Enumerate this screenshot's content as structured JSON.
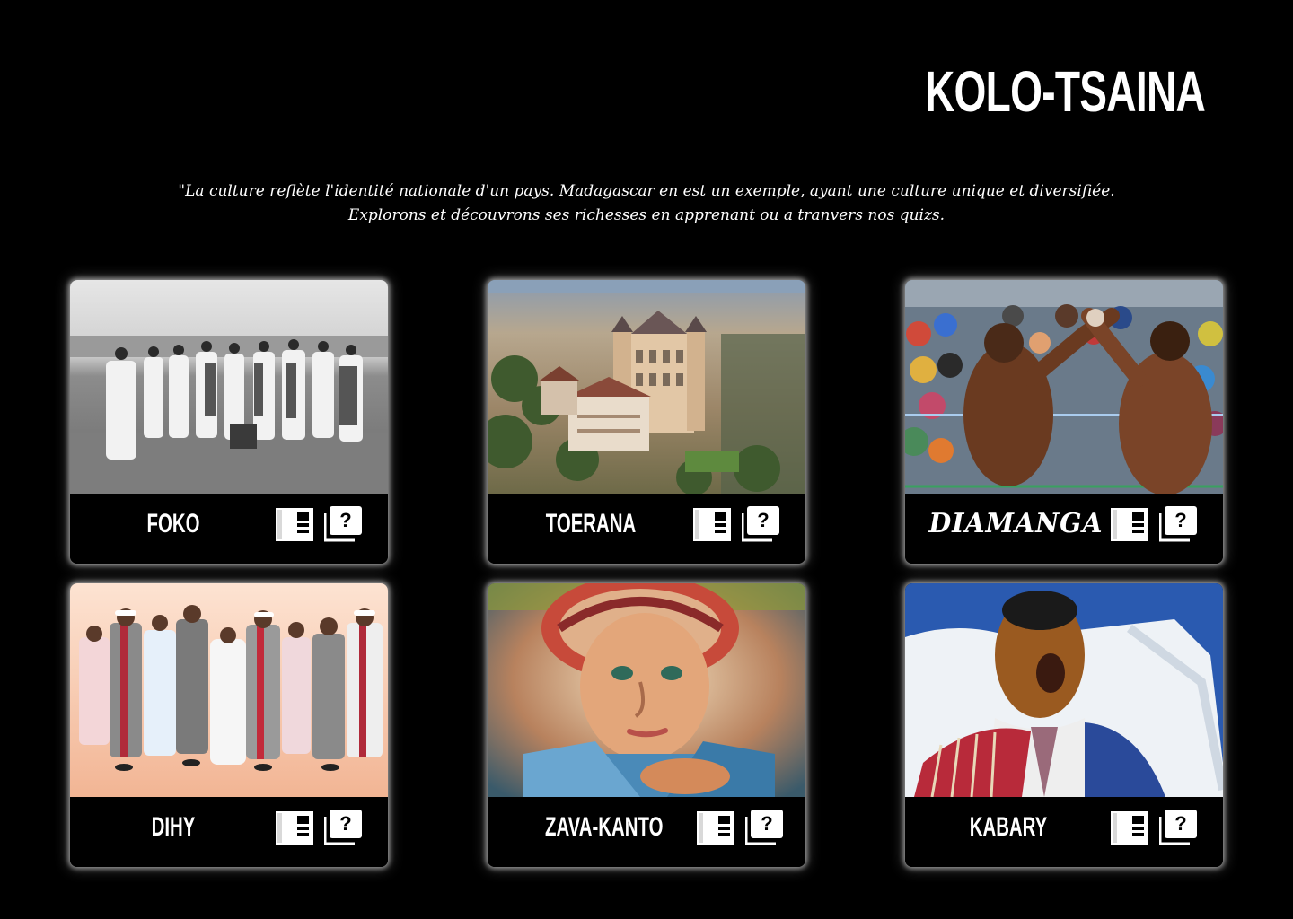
{
  "header": {
    "title": "KOLO-TSAINA"
  },
  "intro": {
    "line1": "\"La culture reflète l'identité nationale d'un pays. Madagascar en est un exemple, ayant une culture unique et diversifiée.",
    "line2": "Explorons et découvrons ses richesses en apprenant ou a tranvers nos quizs."
  },
  "cards": [
    {
      "label": "FOKO",
      "image": "black-and-white photo of group in traditional lamba",
      "lesson_icon": "book-icon",
      "quiz_icon": "quiz-icon"
    },
    {
      "label": "TOERANA",
      "image": "aerial view of palace",
      "lesson_icon": "book-icon",
      "quiz_icon": "quiz-icon"
    },
    {
      "label": "DIAMANGA",
      "image": "two men wrestling in front of crowd",
      "lesson_icon": "book-icon",
      "quiz_icon": "quiz-icon"
    },
    {
      "label": "DIHY",
      "image": "illustration of people dancing",
      "lesson_icon": "book-icon",
      "quiz_icon": "quiz-icon"
    },
    {
      "label": "ZAVA-KANTO",
      "image": "painting of child with straw hat",
      "lesson_icon": "book-icon",
      "quiz_icon": "quiz-icon"
    },
    {
      "label": "KABARY",
      "image": "illustration of orator speaking",
      "lesson_icon": "book-icon",
      "quiz_icon": "quiz-icon"
    }
  ],
  "colors": {
    "background": "#000000",
    "text": "#ffffff",
    "card_glow": "#ffffff"
  }
}
